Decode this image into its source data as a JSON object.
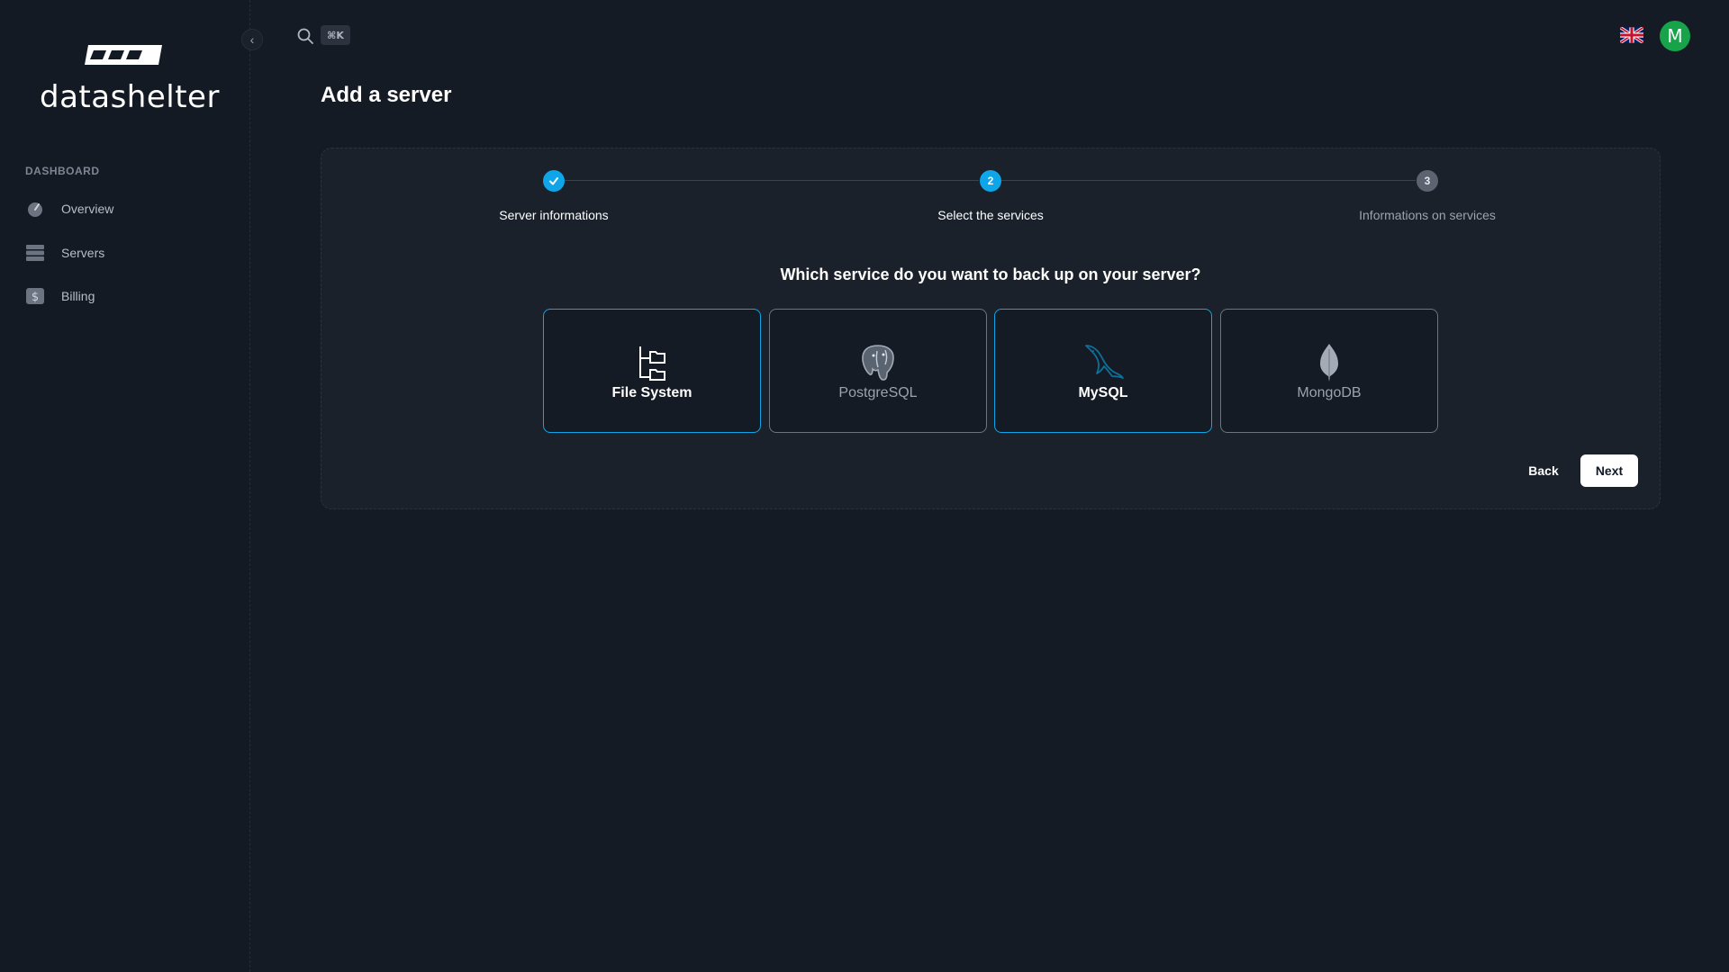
{
  "app": {
    "brand": "datashelter"
  },
  "sidebar": {
    "section_label": "DASHBOARD",
    "items": [
      {
        "label": "Overview",
        "icon": "gauge-icon"
      },
      {
        "label": "Servers",
        "icon": "server-icon"
      },
      {
        "label": "Billing",
        "icon": "dollar-icon"
      }
    ],
    "collapse_icon": "chevron-left-icon"
  },
  "topbar": {
    "search_icon": "search-icon",
    "shortcut": "⌘K",
    "language_flag": "uk-flag-icon",
    "avatar_initial": "M"
  },
  "page": {
    "title": "Add a server"
  },
  "stepper": {
    "steps": [
      {
        "number": "1",
        "label": "Server informations",
        "status": "completed"
      },
      {
        "number": "2",
        "label": "Select the services",
        "status": "current"
      },
      {
        "number": "3",
        "label": "Informations on services",
        "status": "upcoming"
      }
    ]
  },
  "services": {
    "question": "Which service do you want to back up on your server?",
    "options": [
      {
        "label": "File System",
        "icon": "folder-tree-icon",
        "selected": true
      },
      {
        "label": "PostgreSQL",
        "icon": "postgresql-icon",
        "selected": false
      },
      {
        "label": "MySQL",
        "icon": "mysql-icon",
        "selected": true
      },
      {
        "label": "MongoDB",
        "icon": "mongodb-icon",
        "selected": false
      }
    ]
  },
  "actions": {
    "back_label": "Back",
    "next_label": "Next"
  },
  "colors": {
    "accent": "#0ea5e9",
    "background": "#151b24",
    "card": "#1a212b",
    "avatar": "#16a34a"
  }
}
